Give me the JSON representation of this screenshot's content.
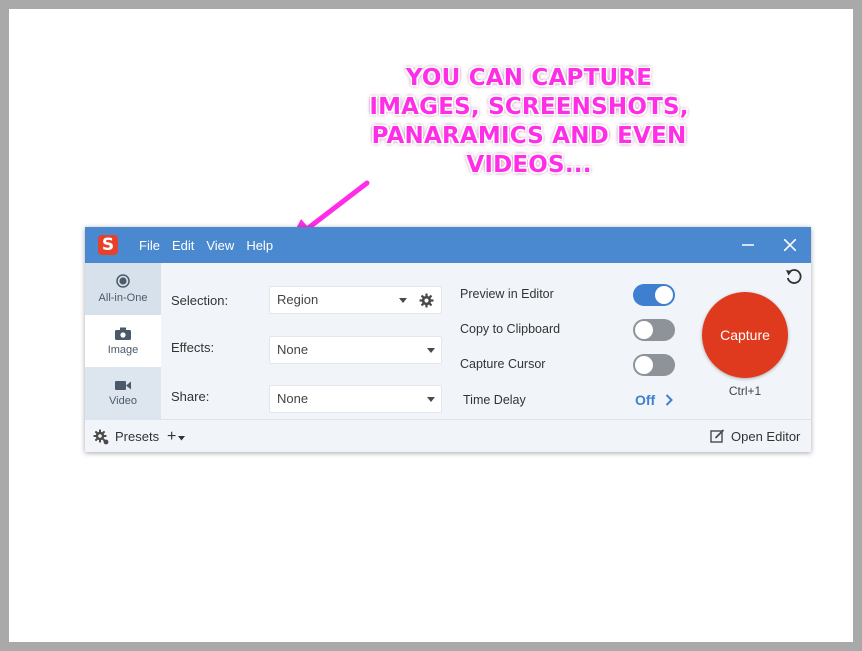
{
  "annotation": {
    "lines": [
      "YOU CAN CAPTURE",
      "IMAGES, SCREENSHOTS,",
      "PANARAMICS AND EVEN",
      "VIDEOS..."
    ],
    "color": "#ff2ee6"
  },
  "app": {
    "logo_letter": "S",
    "menu": [
      "File",
      "Edit",
      "View",
      "Help"
    ],
    "title_bar_color": "#4a89d0",
    "window_controls": {
      "minimize": "—",
      "close": "✕"
    }
  },
  "modes": [
    {
      "label": "All-in-One",
      "icon": "all-in-one-icon",
      "state": "selected"
    },
    {
      "label": "Image",
      "icon": "camera-icon",
      "state": "normal"
    },
    {
      "label": "Video",
      "icon": "video-camera-icon",
      "state": "normal"
    }
  ],
  "settings": {
    "selection": {
      "label": "Selection:",
      "value": "Region"
    },
    "effects": {
      "label": "Effects:",
      "value": "None"
    },
    "share": {
      "label": "Share:",
      "value": "None"
    }
  },
  "options": {
    "preview_in_editor": {
      "label": "Preview in Editor",
      "on": true
    },
    "copy_to_clipboard": {
      "label": "Copy to Clipboard",
      "on": false
    },
    "capture_cursor": {
      "label": "Capture Cursor",
      "on": false
    },
    "time_delay": {
      "label": "Time Delay",
      "value": "Off"
    }
  },
  "capture": {
    "label": "Capture",
    "shortcut": "Ctrl+1",
    "color": "#e03a1e"
  },
  "bottom": {
    "presets_label": "Presets",
    "add_label": "+",
    "open_editor_label": "Open Editor"
  },
  "accent_color": "#3f7fcf"
}
